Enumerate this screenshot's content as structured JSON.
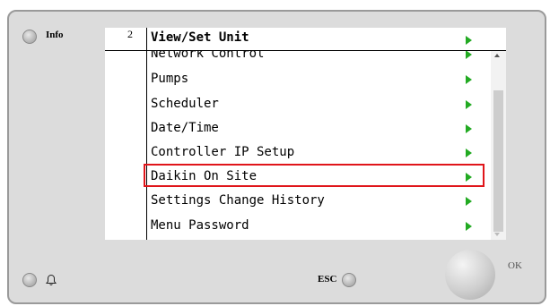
{
  "panel": {
    "info_label": "Info",
    "esc_label": "ESC",
    "ok_label": "OK"
  },
  "screen": {
    "page_number": "2",
    "title": "View/Set Unit",
    "menu_items": [
      {
        "label": "Network Control"
      },
      {
        "label": "Pumps"
      },
      {
        "label": "Scheduler"
      },
      {
        "label": "Date/Time"
      },
      {
        "label": "Controller IP Setup"
      },
      {
        "label": "Daikin On Site",
        "selected": true
      },
      {
        "label": "Settings Change History"
      },
      {
        "label": "Menu Password"
      }
    ]
  },
  "colors": {
    "arrow": "#22aa22",
    "selection": "#e0151a",
    "panel": "#dcdcdc"
  },
  "icons": {
    "info_led": "led-indicator",
    "bell": "bell-icon",
    "esc_led": "led-indicator",
    "ok_knob": "round-button",
    "arrows": "right-triangle-icon"
  }
}
